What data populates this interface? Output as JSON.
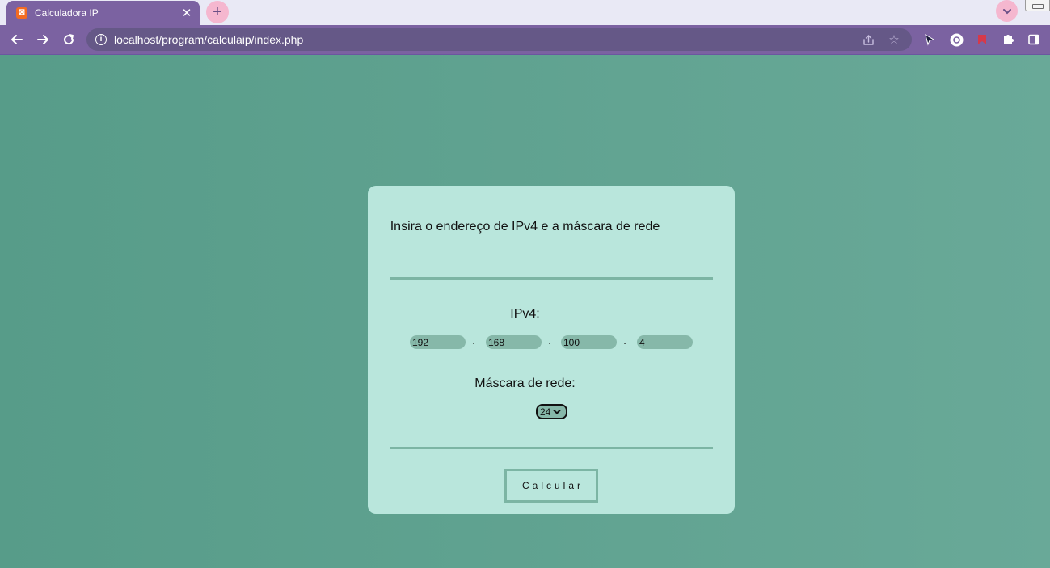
{
  "browser": {
    "tab": {
      "title": "Calculadora IP",
      "favicon": "xampp-icon",
      "close_glyph": "✕"
    },
    "new_tab_glyph": "+",
    "tab_search_glyph": "⌄",
    "url": "localhost/program/calculaip/index.php",
    "info_glyph": "i"
  },
  "page": {
    "title": "Insira o endereço de IPv4 e a máscara de rede",
    "ipv4_label": "IPv4:",
    "octets": [
      "192",
      "168",
      "100",
      "4"
    ],
    "separator": ".",
    "mask_label": "Máscara de rede:",
    "mask_value": "24",
    "button_label": "Calcular"
  },
  "colors": {
    "chrome": "#7b62a1",
    "page_background": "#62a593",
    "card": "#b9e6dc",
    "accent": "#7cb5a4",
    "input": "#86b8a9"
  }
}
